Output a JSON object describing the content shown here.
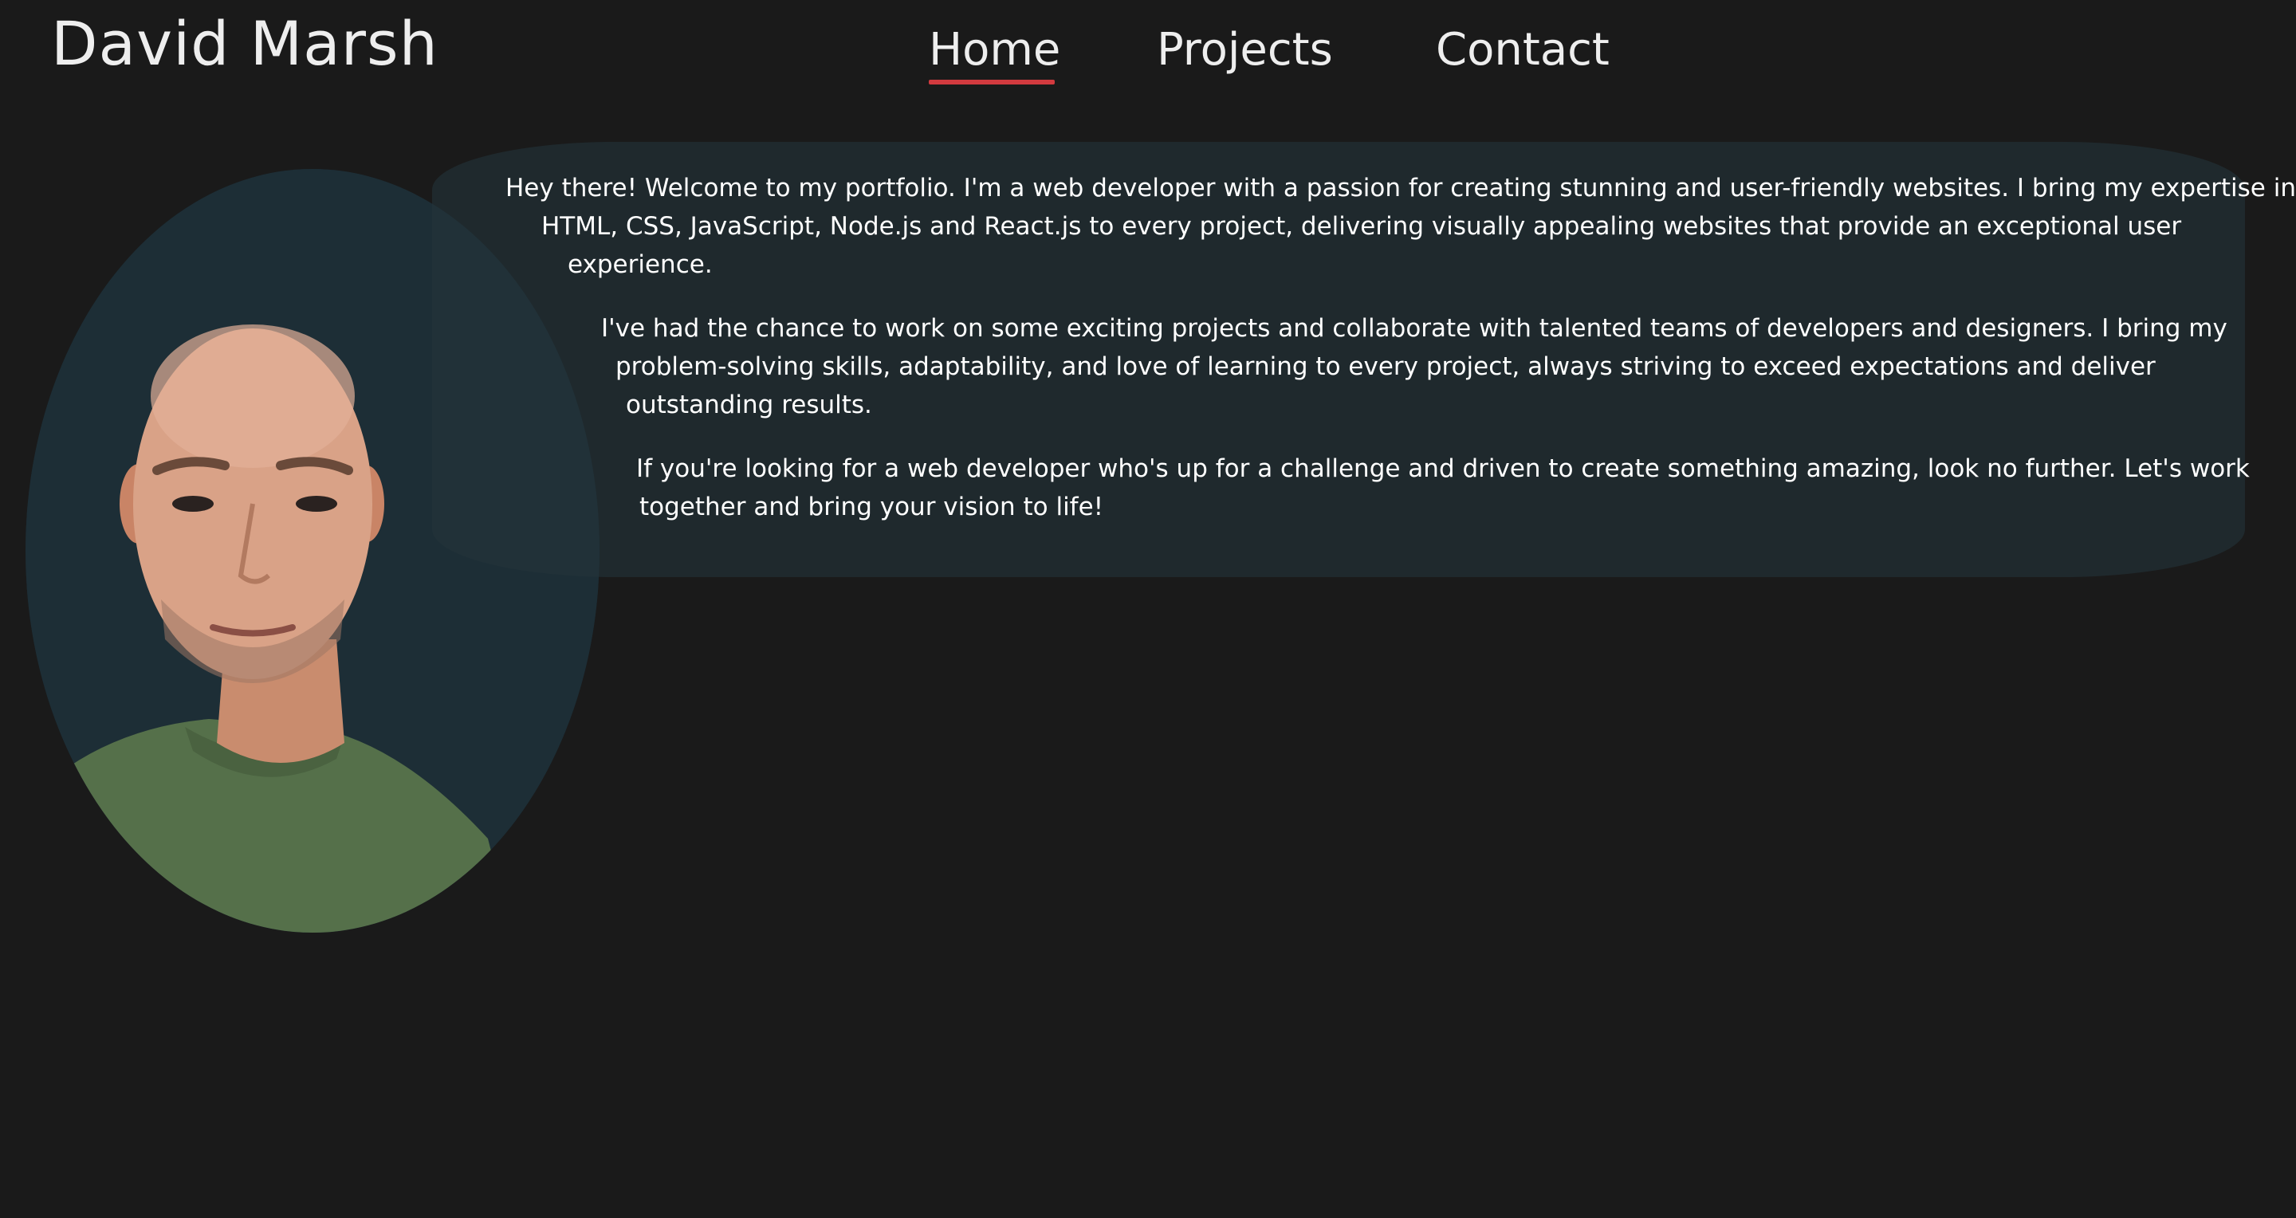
{
  "site": {
    "name": "David Marsh"
  },
  "nav": {
    "items": [
      {
        "label": "Home",
        "active": true
      },
      {
        "label": "Projects",
        "active": false
      },
      {
        "label": "Contact",
        "active": false
      }
    ],
    "active_color": "#d23a3f"
  },
  "portrait": {
    "icon": "profile-photo"
  },
  "about": {
    "paragraphs": [
      {
        "lines": [
          "Hey there! Welcome to my portfolio. I'm a web developer with a passion for creating stunning and user-friendly websites. I bring my expertise in",
          "HTML, CSS, JavaScript, Node.js and React.js to every project, delivering visually appealing websites that provide an exceptional user",
          "experience."
        ]
      },
      {
        "lines": [
          "I've had the chance to work on some exciting projects and collaborate with talented teams of developers and designers. I bring my",
          "problem-solving skills, adaptability, and love of learning to every project, always striving to exceed expectations and deliver",
          "outstanding results."
        ]
      },
      {
        "lines": [
          "If you're looking for a web developer who's up for a challenge and driven to create something amazing, look no further. Let's work",
          "together and bring your vision to life!"
        ]
      }
    ]
  },
  "colors": {
    "background": "#1a1a1a",
    "panel": "#24343a",
    "accent": "#d23a3f",
    "text": "#ffffff"
  }
}
